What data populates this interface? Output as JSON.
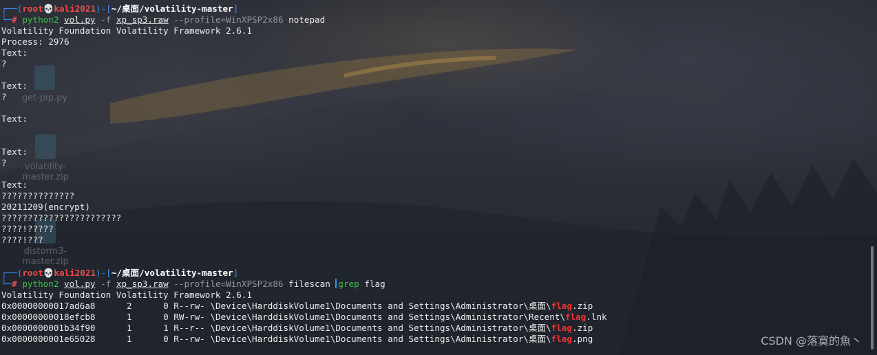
{
  "prompt1": {
    "user": "root",
    "skull": "💀",
    "host": "kali2021",
    "path": "~/桌面/volatility-master",
    "bracket_open": "┌──(",
    "bracket_mid": ")-[",
    "bracket_close": "]",
    "prefix": "└─",
    "hash": "# "
  },
  "cmd1": {
    "program": "python2",
    "script": "vol.py",
    "flag_f": "-f",
    "image": "xp_sp3.raw",
    "profile": "--profile=WinXPSP2x86",
    "plugin": "notepad"
  },
  "output1": [
    "Volatility Foundation Volatility Framework 2.6.1",
    "Process: 2976",
    "Text:",
    "?",
    "",
    "Text:",
    "?",
    "",
    "Text:",
    "",
    "",
    "Text:",
    "?",
    "",
    "Text:",
    "??????????????",
    "20211209(encrypt)",
    "???????????????????????",
    "????!?????",
    "????!???"
  ],
  "prompt2": {
    "user": "root",
    "skull": "💀",
    "host": "kali2021",
    "path": "~/桌面/volatility-master",
    "bracket_open": "┌──(",
    "bracket_mid": ")-[",
    "bracket_close": "]",
    "prefix": "└─",
    "hash": "# "
  },
  "cmd2": {
    "program": "python2",
    "script": "vol.py",
    "flag_f": "-f",
    "image": "xp_sp3.raw",
    "profile": "--profile=WinXPSP2x86",
    "plugin": "filescan",
    "pipe_cmd": "grep",
    "pipe_arg": "flag"
  },
  "output2": {
    "header": "Volatility Foundation Volatility Framework 2.6.1",
    "rows": [
      {
        "offset": "0x00000000017ad6a8",
        "ptr": "2",
        "hnd": "0",
        "access": "R--rw-",
        "path": "\\Device\\HarddiskVolume1\\Documents and Settings\\Administrator\\桌面\\",
        "match": "flag",
        "ext": ".zip"
      },
      {
        "offset": "0x00000000018efcb8",
        "ptr": "1",
        "hnd": "0",
        "access": "RW-rw-",
        "path": "\\Device\\HarddiskVolume1\\Documents and Settings\\Administrator\\Recent\\",
        "match": "flag",
        "ext": ".lnk"
      },
      {
        "offset": "0x0000000001b34f90",
        "ptr": "1",
        "hnd": "1",
        "access": "R--r--",
        "path": "\\Device\\HarddiskVolume1\\Documents and Settings\\Administrator\\桌面\\",
        "match": "flag",
        "ext": ".zip"
      },
      {
        "offset": "0x0000000001e65028",
        "ptr": "1",
        "hnd": "0",
        "access": "R--rw-",
        "path": "\\Device\\HarddiskVolume1\\Documents and Settings\\Administrator\\桌面\\",
        "match": "flag",
        "ext": ".png"
      }
    ]
  },
  "desktop_icons": [
    {
      "label": "get-pip.py",
      "icon": "python-file-icon"
    },
    {
      "label": "volatility-master.zip",
      "icon": "zip-archive-icon"
    },
    {
      "label": "distorm3-master.zip",
      "icon": "zip-archive-icon"
    }
  ],
  "watermark": "CSDN @落寞的魚丶",
  "colors": {
    "prompt_blue": "#3b8eea",
    "prompt_red": "#e84c4c",
    "command_green": "#39c24a",
    "option_grey": "#8d96a3",
    "match_red": "#f03232"
  }
}
